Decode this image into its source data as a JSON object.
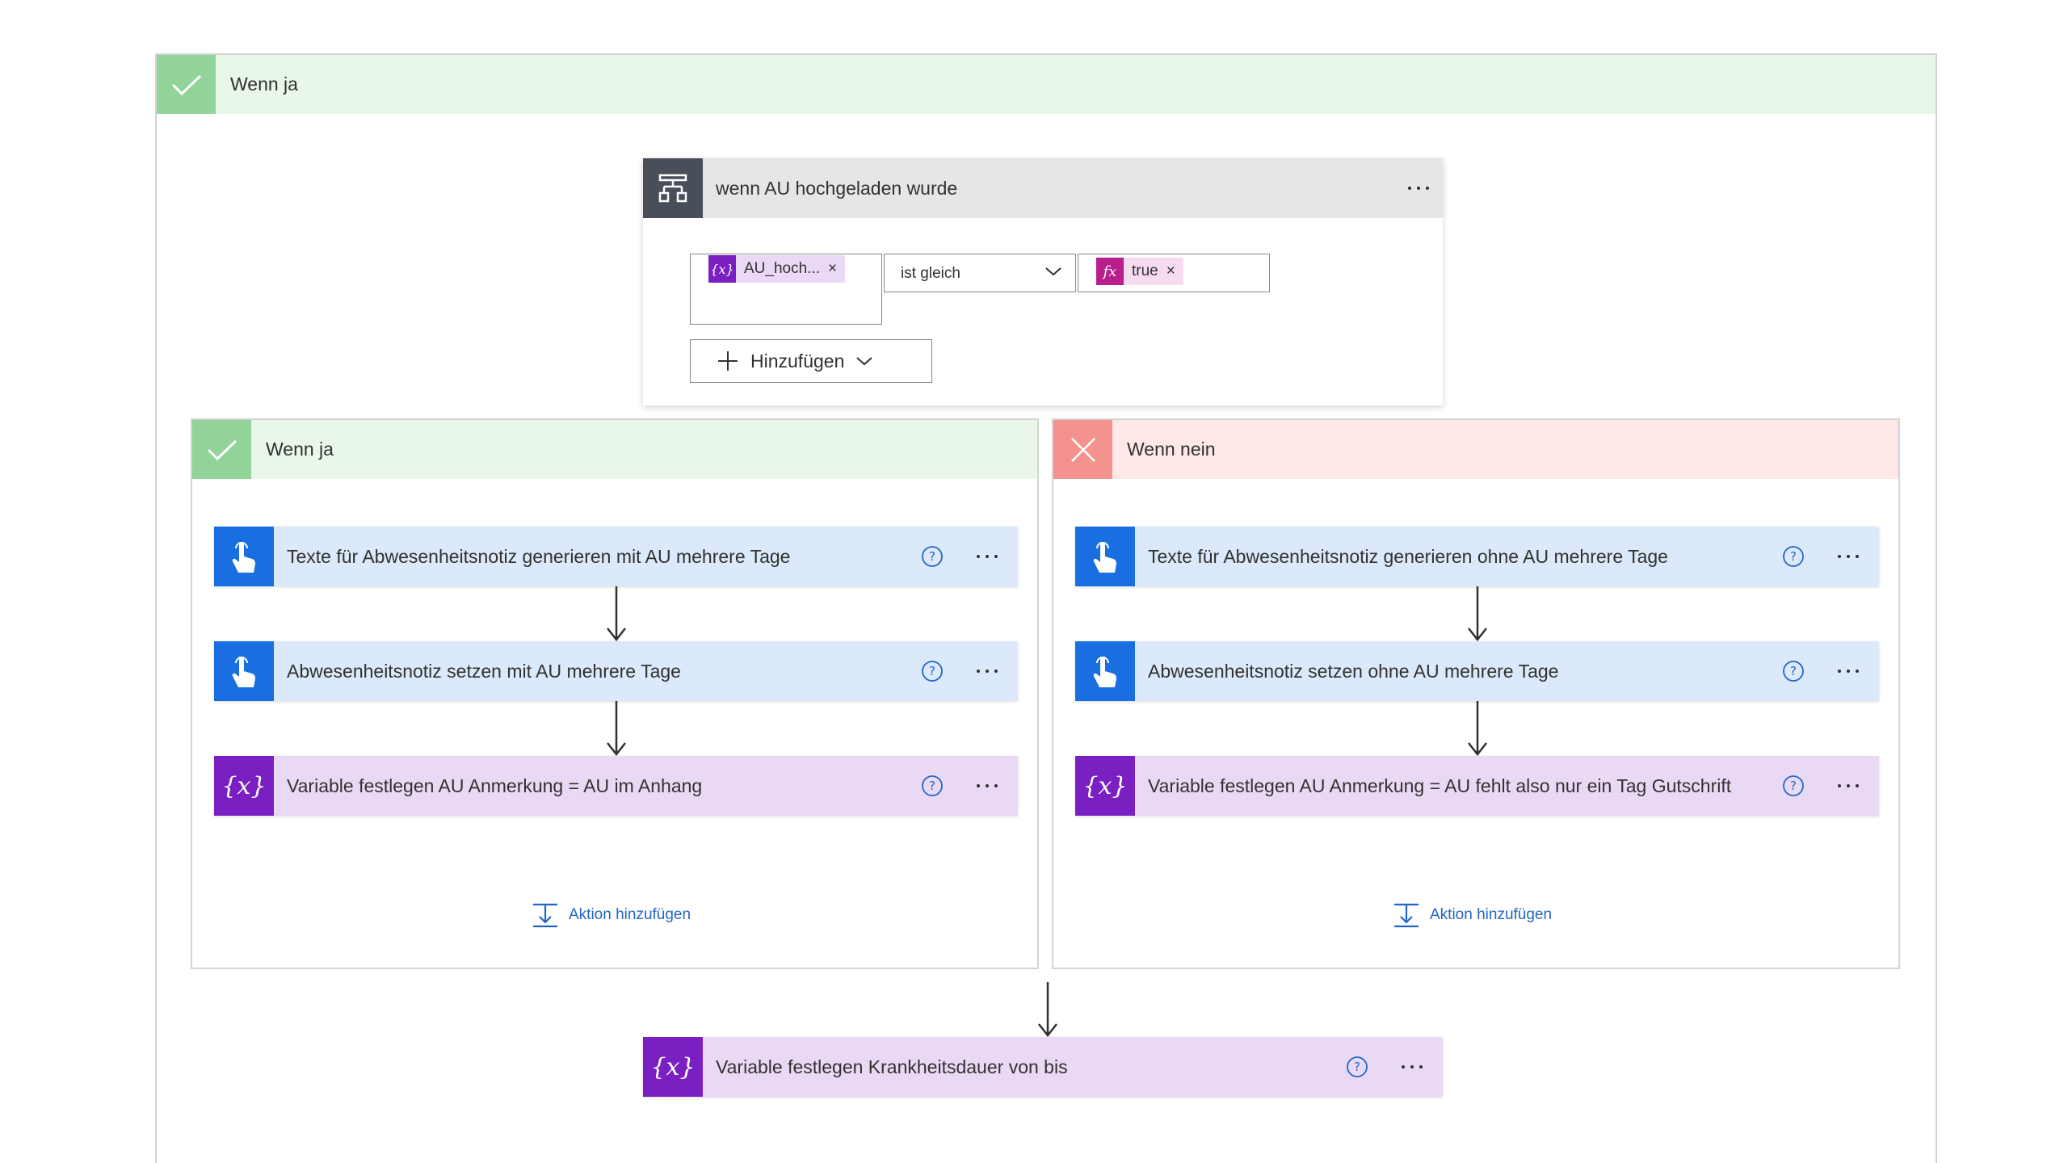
{
  "outer_scope": {
    "title": "Wenn ja"
  },
  "condition": {
    "title": "wenn AU hochgeladen wurde",
    "left_token": {
      "label": "AU_hoch...",
      "icon": "variable-icon"
    },
    "operator": "ist gleich",
    "right_token": {
      "label": "true",
      "icon": "fx-icon"
    },
    "remove_symbol": "×",
    "add_label": "Hinzufügen"
  },
  "yes_branch": {
    "title": "Wenn ja",
    "actions": [
      {
        "label": "Texte für Abwesenheitsnotiz generieren mit AU mehrere Tage",
        "type": "blue"
      },
      {
        "label": "Abwesenheitsnotiz setzen mit AU mehrere Tage",
        "type": "blue"
      },
      {
        "label": "Variable festlegen AU Anmerkung = AU im Anhang",
        "type": "purple"
      }
    ],
    "add_action_label": "Aktion hinzufügen"
  },
  "no_branch": {
    "title": "Wenn nein",
    "actions": [
      {
        "label": "Texte für Abwesenheitsnotiz generieren ohne AU mehrere Tage",
        "type": "blue"
      },
      {
        "label": "Abwesenheitsnotiz setzen ohne AU mehrere Tage",
        "type": "blue"
      },
      {
        "label": "Variable festlegen AU Anmerkung = AU fehlt also nur ein Tag Gutschrift",
        "type": "purple"
      }
    ],
    "add_action_label": "Aktion hinzufügen"
  },
  "final_action": {
    "label": "Variable festlegen Krankheitsdauer von bis",
    "type": "purple"
  },
  "colors": {
    "yes_header": "#e9f7e9",
    "yes_icon": "#92d39a",
    "no_header": "#fde7e7",
    "no_icon": "#f4938e",
    "blue_action": "#dbe9fa",
    "blue_icon": "#1a6fe0",
    "purple_action": "#ead9f4",
    "purple_icon": "#7a1fc2",
    "link": "#2266c4"
  }
}
